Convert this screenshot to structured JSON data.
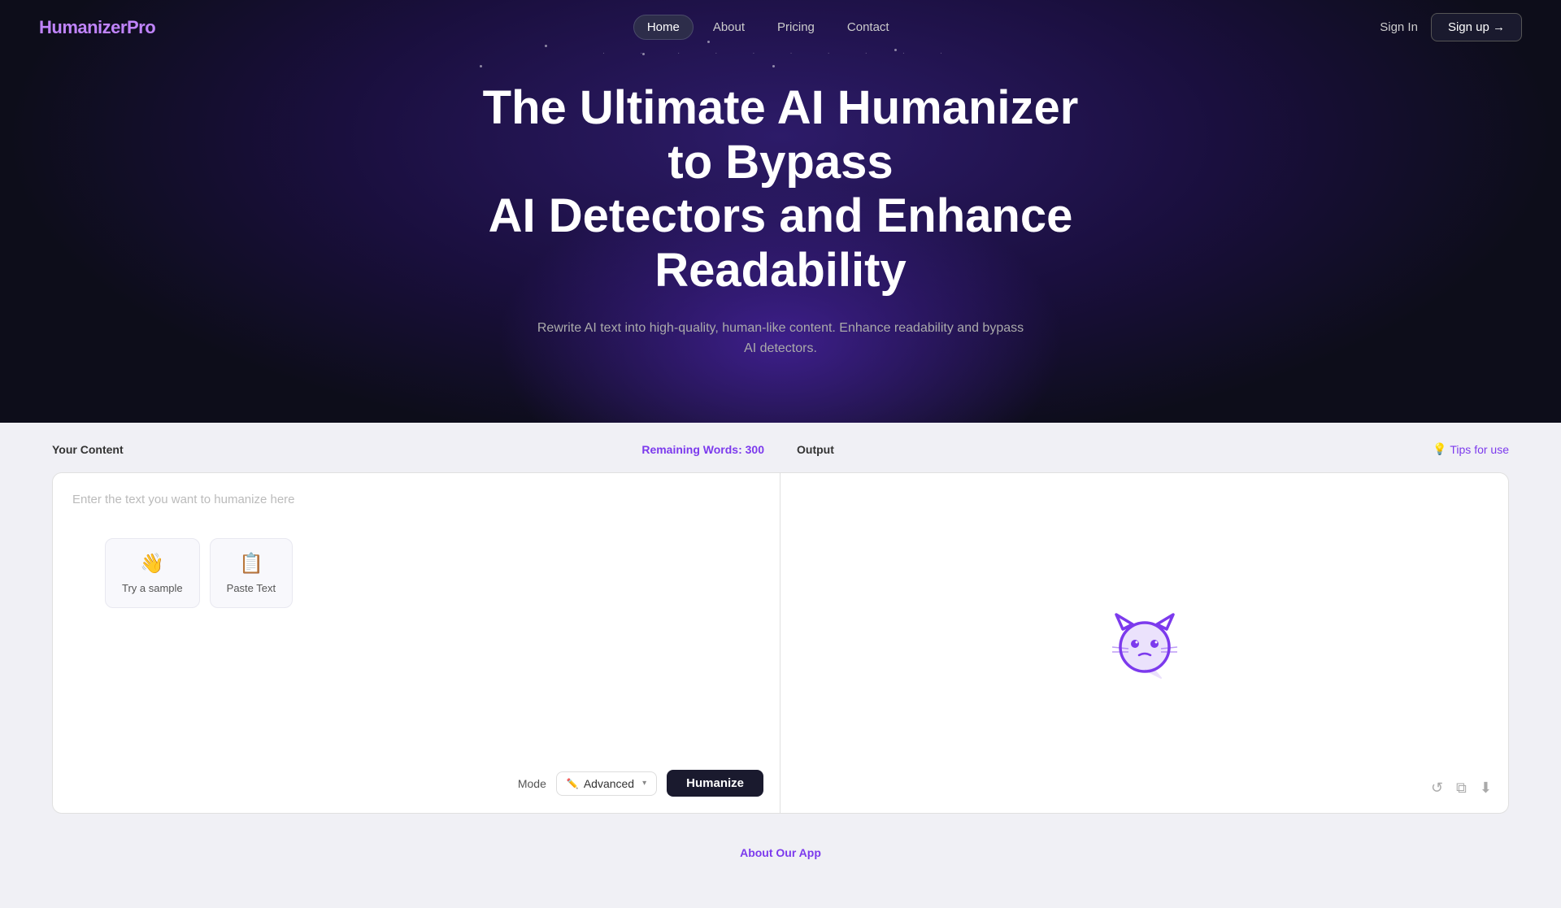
{
  "brand": {
    "name_prefix": "Humanizer",
    "name_suffix": "Pro"
  },
  "nav": {
    "links": [
      {
        "label": "Home",
        "active": true
      },
      {
        "label": "About",
        "active": false
      },
      {
        "label": "Pricing",
        "active": false
      },
      {
        "label": "Contact",
        "active": false
      }
    ],
    "sign_in_label": "Sign In",
    "sign_up_label": "Sign up →"
  },
  "hero": {
    "title_line1": "The Ultimate AI Humanizer to Bypass",
    "title_line2": "AI Detectors and Enhance Readability",
    "subtitle": "Rewrite AI text into high-quality, human-like content. Enhance readability and bypass AI detectors."
  },
  "content_panel": {
    "label": "Your Content",
    "remaining_label": "Remaining Words: 300",
    "placeholder": "Enter the text you want to humanize here",
    "try_sample_label": "Try a sample",
    "paste_text_label": "Paste Text",
    "mode_label": "Mode",
    "mode_value": "Advanced",
    "humanize_label": "Humanize"
  },
  "output_panel": {
    "label": "Output",
    "tips_label": "Tips for use",
    "icons": {
      "refresh": "↺",
      "copy": "⧉",
      "download": "⬇"
    }
  },
  "about": {
    "link_label": "About Our App"
  }
}
